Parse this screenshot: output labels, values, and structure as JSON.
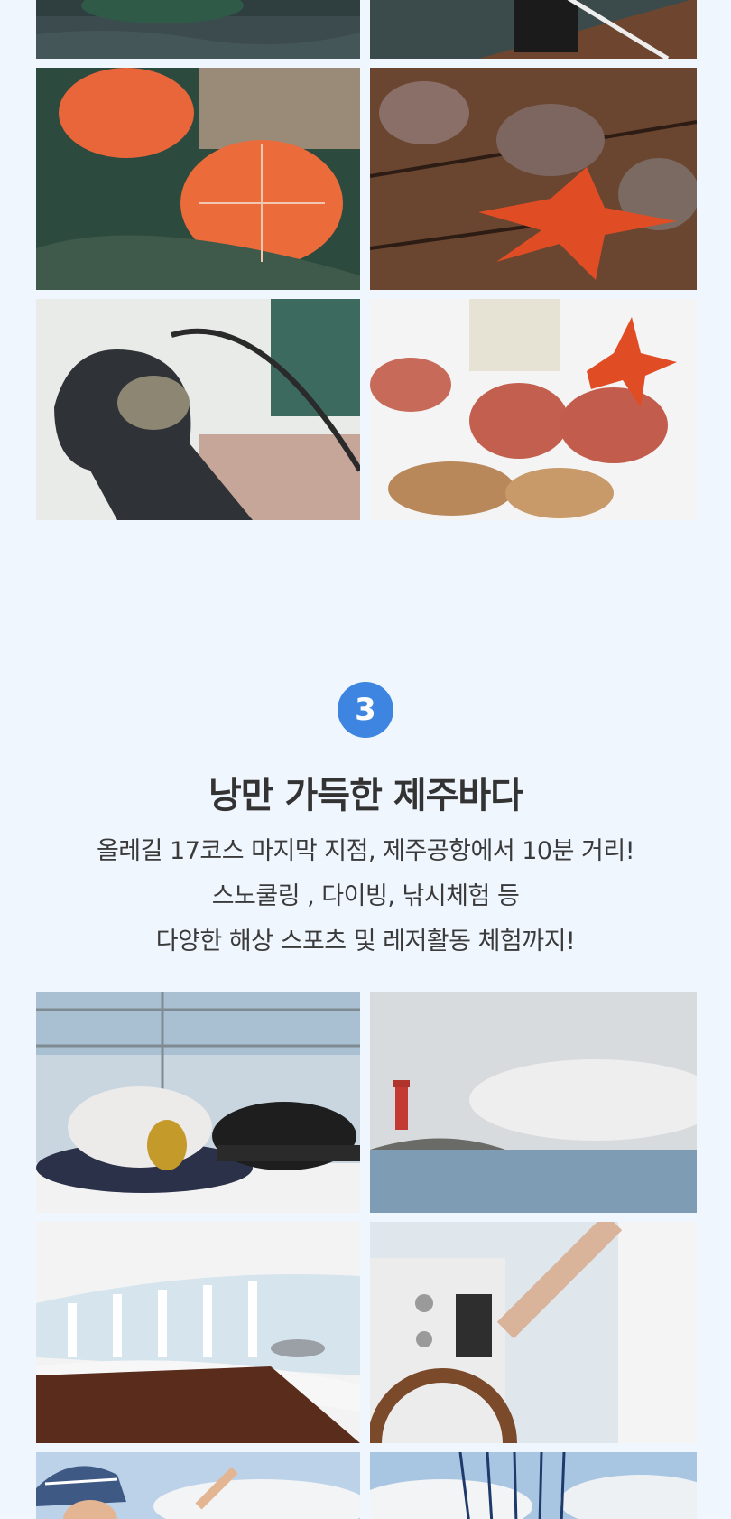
{
  "section": {
    "number": "3",
    "title": "낭만 가득한 제주바다",
    "description": [
      "올레길 17코스 마지막 지점, 제주공항에서 10분 거리!",
      "스노쿨링 , 다이빙, 낚시체험 등",
      "다양한 해상 스포츠 및 레저활동 체험까지!"
    ]
  },
  "colors": {
    "background": "#f0f6fe",
    "badge": "#3d85e0",
    "text": "#333333"
  }
}
